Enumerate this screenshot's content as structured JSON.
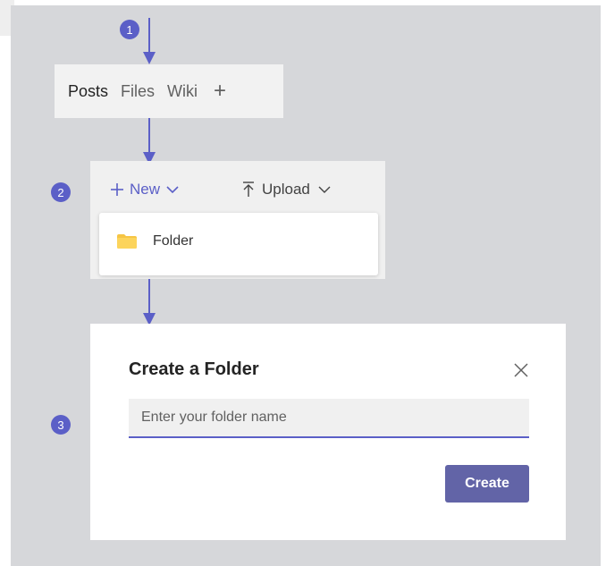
{
  "steps": {
    "one": "1",
    "two": "2",
    "three": "3"
  },
  "tabs": [
    {
      "label": "Posts",
      "active": true
    },
    {
      "label": "Files",
      "active": false
    },
    {
      "label": "Wiki",
      "active": false
    }
  ],
  "tab_add_label": "+",
  "toolbar": {
    "new_label": "New",
    "upload_label": "Upload"
  },
  "dropdown": {
    "folder_label": "Folder"
  },
  "dialog": {
    "title": "Create a Folder",
    "input_placeholder": "Enter your folder name",
    "input_value": "",
    "create_label": "Create"
  },
  "colors": {
    "accent": "#5b5fc7",
    "button": "#6264a7",
    "folder": "#f6c544",
    "canvas": "#d6d7da"
  },
  "icons": [
    "plus-icon",
    "chevron-down-icon",
    "upload-icon",
    "folder-icon",
    "close-icon",
    "arrow-down-icon"
  ]
}
